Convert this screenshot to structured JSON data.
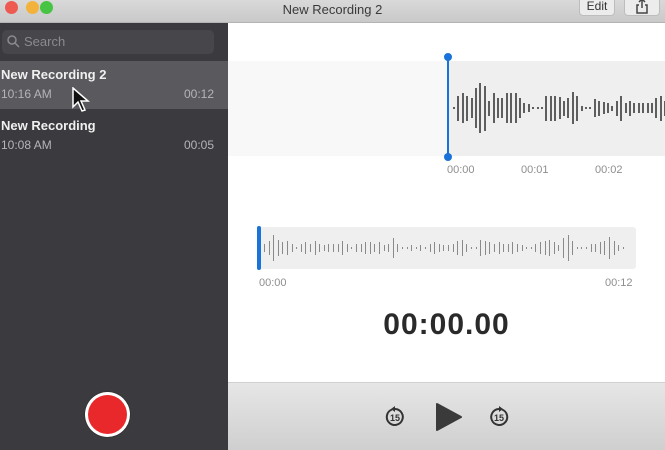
{
  "window": {
    "title": "New Recording 2",
    "edit_label": "Edit"
  },
  "sidebar": {
    "search_placeholder": "Search",
    "recordings": [
      {
        "name": "New Recording 2",
        "time": "10:16 AM",
        "duration": "00:12",
        "selected": true
      },
      {
        "name": "New Recording",
        "time": "10:08 AM",
        "duration": "00:05",
        "selected": false
      }
    ]
  },
  "detail": {
    "zoomed_ticks": [
      "00:00",
      "00:01",
      "00:02"
    ],
    "overview_start": "00:00",
    "overview_end": "00:12",
    "current_time": "00:00.00",
    "zoomed_amplitudes": [
      0.05,
      0.5,
      0.6,
      0.5,
      0.4,
      0.8,
      1,
      0.9,
      0.3,
      0.6,
      0.4,
      0.4,
      0.6,
      0.6,
      0.6,
      0.4,
      0.2,
      0.15,
      0.05,
      0.05,
      0.05,
      0.5,
      0.5,
      0.5,
      0.45,
      0.3,
      0.4,
      0.65,
      0.5,
      0.1,
      0.05,
      0.05,
      0.35,
      0.3,
      0.25,
      0.2,
      0.1,
      0.3,
      0.5,
      0.2,
      0.3,
      0.2,
      0.2,
      0.2,
      0.2,
      0.2,
      0.4,
      0.5,
      0.3
    ],
    "overview_amplitudes": [
      0.3,
      0.5,
      0.9,
      0.6,
      0.4,
      0.5,
      0.3,
      0.1,
      0.3,
      0.4,
      0.3,
      0.5,
      0.3,
      0.2,
      0.3,
      0.3,
      0.3,
      0.5,
      0.3,
      0.1,
      0.3,
      0.3,
      0.4,
      0.4,
      0.3,
      0.4,
      0.2,
      0.3,
      0.7,
      0.3,
      0.05,
      0.05,
      0.2,
      0.1,
      0.2,
      0.05,
      0.3,
      0.4,
      0.3,
      0.2,
      0.2,
      0.3,
      0.5,
      0.6,
      0.3,
      0.05,
      0.05,
      0.6,
      0.5,
      0.4,
      0.3,
      0.4,
      0.3,
      0.3,
      0.4,
      0.3,
      0.2,
      0.05,
      0.05,
      0.3,
      0.4,
      0.5,
      0.6,
      0.4,
      0.2,
      0.7,
      0.9,
      0.5,
      0.05,
      0.05,
      0.05,
      0.3,
      0.3,
      0.4,
      0.5,
      0.8,
      0.5,
      0.2,
      0.05
    ]
  },
  "controls": {
    "skip_back_label": "15",
    "skip_forward_label": "15"
  },
  "colors": {
    "accent": "#1a73d9",
    "record": "#e8282b"
  }
}
